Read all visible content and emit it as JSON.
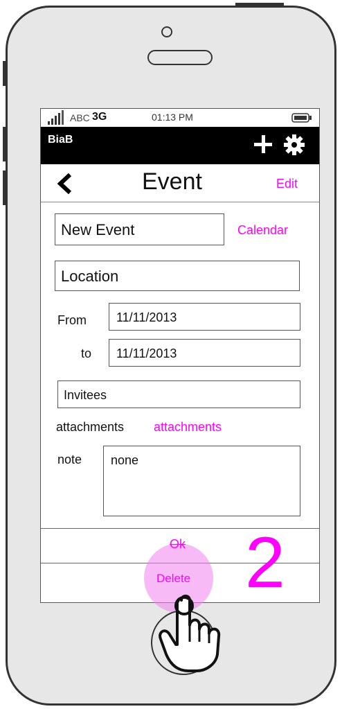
{
  "status": {
    "carrier": "ABC",
    "network": "3G",
    "time": "01:13 PM"
  },
  "app": {
    "title": "BiaB"
  },
  "nav": {
    "title": "Event",
    "edit_label": "Edit"
  },
  "form": {
    "event_name": "New Event",
    "calendar_label": "Calendar",
    "location": "Location",
    "from_label": "From",
    "from_value": "11/11/2013",
    "to_label": "to",
    "to_value": "11/11/2013",
    "invitees": "Invitees",
    "attachments_label": "attachments",
    "attachments_link": "attachments",
    "note_label": "note",
    "note_value": "none"
  },
  "actions": {
    "ok_label": "Ok",
    "delete_label": "Delete"
  },
  "annotation": {
    "step": "2"
  },
  "colors": {
    "accent": "#ff00ff",
    "appbar": "#000000",
    "frame": "#e7e7e7"
  }
}
